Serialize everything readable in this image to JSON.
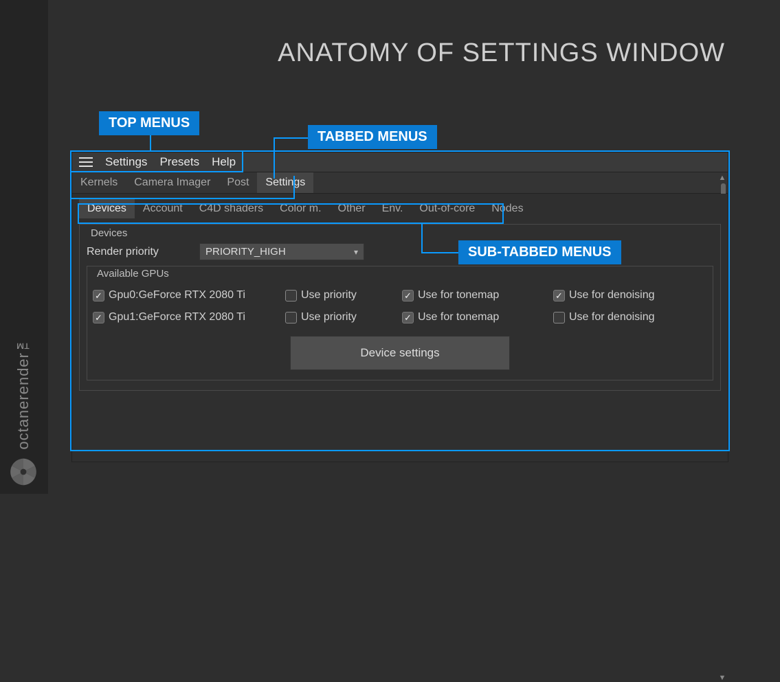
{
  "page_title": "ANATOMY OF SETTINGS WINDOW",
  "brand": "octanerender™",
  "callouts": {
    "top_menus": "TOP MENUS",
    "tabbed": "TABBED MENUS",
    "sub_tabbed": "SUB-TABBED MENUS"
  },
  "menubar": {
    "items": [
      "Settings",
      "Presets",
      "Help"
    ]
  },
  "tabs": {
    "items": [
      "Kernels",
      "Camera Imager",
      "Post",
      "Settings"
    ],
    "active": 3
  },
  "subtabs": {
    "items": [
      "Devices",
      "Account",
      "C4D shaders",
      "Color m.",
      "Other",
      "Env.",
      "Out-of-core",
      "Nodes"
    ],
    "active": 0
  },
  "devices_group_title": "Devices",
  "render_priority": {
    "label": "Render priority",
    "value": "PRIORITY_HIGH"
  },
  "available_gpus_title": "Available GPUs",
  "gpu_columns": {
    "use_priority": "Use priority",
    "use_tonemap": "Use for tonemap",
    "use_denoise": "Use for denoising"
  },
  "gpus": [
    {
      "name": "Gpu0:GeForce RTX 2080 Ti",
      "enabled": true,
      "use_priority": false,
      "use_tonemap": true,
      "use_denoise": true
    },
    {
      "name": "Gpu1:GeForce RTX 2080 Ti",
      "enabled": true,
      "use_priority": false,
      "use_tonemap": true,
      "use_denoise": false
    }
  ],
  "device_settings_button": "Device settings"
}
